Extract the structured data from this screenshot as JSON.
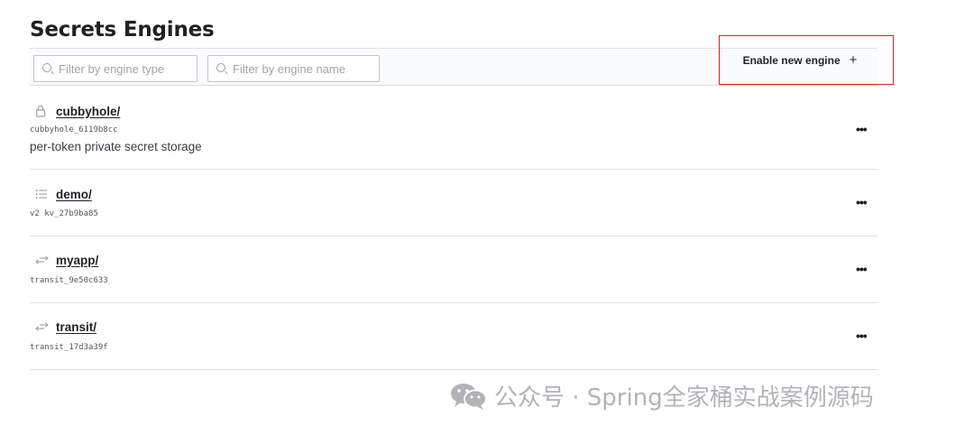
{
  "page": {
    "title": "Secrets Engines"
  },
  "toolbar": {
    "filter_type_placeholder": "Filter by engine type",
    "filter_name_placeholder": "Filter by engine name",
    "enable_label": "Enable new engine",
    "enable_icon": "plus-icon"
  },
  "engines": [
    {
      "icon": "lock-icon",
      "name": "cubbyhole/",
      "accessor": "cubbyhole_6119b8cc",
      "description": "per-token private secret storage",
      "more_label": "•••"
    },
    {
      "icon": "list-icon",
      "name": "demo/",
      "accessor": "v2 kv_27b9ba85",
      "more_label": "•••"
    },
    {
      "icon": "transit-arrows-icon",
      "name": "myapp/",
      "accessor": "transit_9e50c633",
      "more_label": "•••"
    },
    {
      "icon": "transit-arrows-icon",
      "name": "transit/",
      "accessor": "transit_17d3a39f",
      "more_label": "•••"
    }
  ],
  "watermark": {
    "text": "公众号 · Spring全家桶实战案例源码",
    "icon": "wechat-icon"
  },
  "colors": {
    "highlight_box": "#e02020",
    "text_primary": "#1f2124",
    "divider": "#dce0e6"
  }
}
